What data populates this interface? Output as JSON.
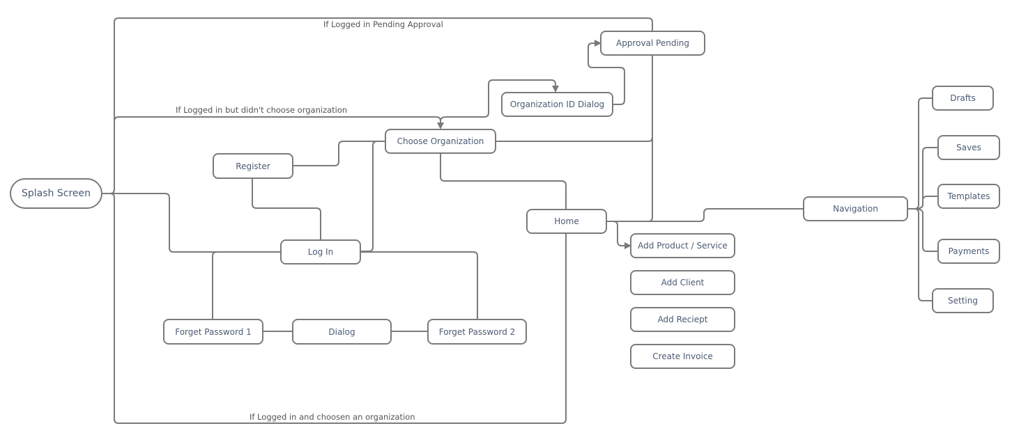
{
  "diagram": {
    "colors": {
      "line": "#7a7a7a",
      "node_text": "#4b5a73",
      "label_text": "#555555"
    },
    "nodes": {
      "splash": "Splash Screen",
      "register": "Register",
      "login": "Log In",
      "forget1": "Forget Password 1",
      "dialog": "Dialog",
      "forget2": "Forget Password 2",
      "choose_org": "Choose Organization",
      "org_id_dialog": "Organization ID Dialog",
      "approval_pending": "Approval Pending",
      "home": "Home",
      "add_product": "Add Product / Service",
      "add_client": "Add Client",
      "add_receipt": "Add Reciept",
      "create_invoice": "Create Invoice",
      "navigation": "Navigation",
      "drafts": "Drafts",
      "saves": "Saves",
      "templates": "Templates",
      "payments": "Payments",
      "setting": "Setting"
    },
    "edge_labels": {
      "pending_approval": "If Logged in Pending Approval",
      "no_org": "If Logged in but didn't choose organization",
      "has_org": "If Logged in and choosen an organization"
    }
  }
}
